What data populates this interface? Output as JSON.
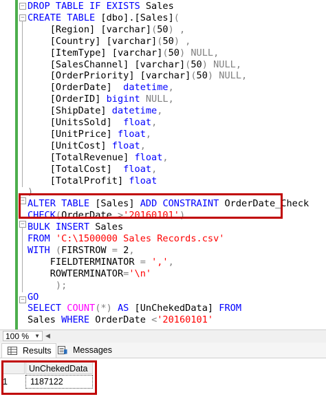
{
  "editor": {
    "lines": [
      [
        {
          "t": "DROP TABLE IF EXISTS",
          "c": "kw"
        },
        {
          "t": " Sales",
          "c": ""
        }
      ],
      [
        {
          "t": "CREATE TABLE",
          "c": "kw"
        },
        {
          "t": " [dbo].[Sales]",
          "c": ""
        },
        {
          "t": "(",
          "c": "gray"
        }
      ],
      [
        {
          "t": "    [Region] [varchar]",
          "c": ""
        },
        {
          "t": "(",
          "c": "gray"
        },
        {
          "t": "50",
          "c": ""
        },
        {
          "t": ") ,",
          "c": "gray"
        }
      ],
      [
        {
          "t": "    [Country] [varchar]",
          "c": ""
        },
        {
          "t": "(",
          "c": "gray"
        },
        {
          "t": "50",
          "c": ""
        },
        {
          "t": ") ,",
          "c": "gray"
        }
      ],
      [
        {
          "t": "    [ItemType] [varchar]",
          "c": ""
        },
        {
          "t": "(",
          "c": "gray"
        },
        {
          "t": "50",
          "c": ""
        },
        {
          "t": ") NULL,",
          "c": "gray"
        }
      ],
      [
        {
          "t": "    [SalesChannel] [varchar]",
          "c": ""
        },
        {
          "t": "(",
          "c": "gray"
        },
        {
          "t": "50",
          "c": ""
        },
        {
          "t": ") NULL,",
          "c": "gray"
        }
      ],
      [
        {
          "t": "    [OrderPriority] [varchar]",
          "c": ""
        },
        {
          "t": "(",
          "c": "gray"
        },
        {
          "t": "50",
          "c": ""
        },
        {
          "t": ") NULL,",
          "c": "gray"
        }
      ],
      [
        {
          "t": "    [OrderDate]  ",
          "c": ""
        },
        {
          "t": "datetime",
          "c": "kw"
        },
        {
          "t": ",",
          "c": "gray"
        }
      ],
      [
        {
          "t": "    [OrderID] ",
          "c": ""
        },
        {
          "t": "bigint",
          "c": "kw"
        },
        {
          "t": " NULL,",
          "c": "gray"
        }
      ],
      [
        {
          "t": "    [ShipDate] ",
          "c": ""
        },
        {
          "t": "datetime",
          "c": "kw"
        },
        {
          "t": ",",
          "c": "gray"
        }
      ],
      [
        {
          "t": "    [UnitsSold]  ",
          "c": ""
        },
        {
          "t": "float",
          "c": "kw"
        },
        {
          "t": ",",
          "c": "gray"
        }
      ],
      [
        {
          "t": "    [UnitPrice] ",
          "c": ""
        },
        {
          "t": "float",
          "c": "kw"
        },
        {
          "t": ",",
          "c": "gray"
        }
      ],
      [
        {
          "t": "    [UnitCost] ",
          "c": ""
        },
        {
          "t": "float",
          "c": "kw"
        },
        {
          "t": ",",
          "c": "gray"
        }
      ],
      [
        {
          "t": "    [TotalRevenue] ",
          "c": ""
        },
        {
          "t": "float",
          "c": "kw"
        },
        {
          "t": ",",
          "c": "gray"
        }
      ],
      [
        {
          "t": "    [TotalCost]  ",
          "c": ""
        },
        {
          "t": "float",
          "c": "kw"
        },
        {
          "t": ",",
          "c": "gray"
        }
      ],
      [
        {
          "t": "    [TotalProfit] ",
          "c": ""
        },
        {
          "t": "float",
          "c": "kw"
        }
      ],
      [
        {
          "t": ")",
          "c": "gray"
        }
      ],
      [
        {
          "t": "ALTER TABLE",
          "c": "kw"
        },
        {
          "t": " [Sales] ",
          "c": ""
        },
        {
          "t": "ADD CONSTRAINT",
          "c": "kw"
        },
        {
          "t": " OrderDate_Check",
          "c": ""
        }
      ],
      [
        {
          "t": "CHECK",
          "c": "kw"
        },
        {
          "t": "(",
          "c": "gray"
        },
        {
          "t": "OrderDate ",
          "c": ""
        },
        {
          "t": ">",
          "c": "gray"
        },
        {
          "t": "'20160101'",
          "c": "str"
        },
        {
          "t": ")",
          "c": "gray"
        }
      ],
      [
        {
          "t": "BULK INSERT",
          "c": "kw"
        },
        {
          "t": " Sales",
          "c": ""
        }
      ],
      [
        {
          "t": "FROM",
          "c": "kw"
        },
        {
          "t": " ",
          "c": ""
        },
        {
          "t": "'C:\\1500000 Sales Records.csv'",
          "c": "str"
        }
      ],
      [
        {
          "t": "WITH",
          "c": "kw"
        },
        {
          "t": " (",
          "c": "gray"
        },
        {
          "t": "FIRSTROW ",
          "c": ""
        },
        {
          "t": "=",
          "c": "gray"
        },
        {
          "t": " 2",
          "c": ""
        },
        {
          "t": ",",
          "c": "gray"
        }
      ],
      [
        {
          "t": "    FIELDTERMINATOR ",
          "c": ""
        },
        {
          "t": "=",
          "c": "gray"
        },
        {
          "t": " ",
          "c": ""
        },
        {
          "t": "','",
          "c": "str"
        },
        {
          "t": ",",
          "c": "gray"
        }
      ],
      [
        {
          "t": "    ROWTERMINATOR",
          "c": ""
        },
        {
          "t": "=",
          "c": "gray"
        },
        {
          "t": "'\\n'",
          "c": "str"
        }
      ],
      [
        {
          "t": "     );",
          "c": "gray"
        }
      ],
      [
        {
          "t": "GO",
          "c": "kw"
        }
      ],
      [
        {
          "t": "SELECT",
          "c": "kw"
        },
        {
          "t": " ",
          "c": ""
        },
        {
          "t": "COUNT",
          "c": "fn"
        },
        {
          "t": "(",
          "c": "gray"
        },
        {
          "t": "*",
          "c": "gray"
        },
        {
          "t": ")",
          "c": "gray"
        },
        {
          "t": " ",
          "c": ""
        },
        {
          "t": "AS",
          "c": "kw"
        },
        {
          "t": " [UnChekedData] ",
          "c": ""
        },
        {
          "t": "FROM",
          "c": "kw"
        }
      ],
      [
        {
          "t": "Sales ",
          "c": ""
        },
        {
          "t": "WHERE",
          "c": "kw"
        },
        {
          "t": " OrderDate ",
          "c": ""
        },
        {
          "t": "<",
          "c": "gray"
        },
        {
          "t": "'20160101'",
          "c": "str"
        }
      ]
    ]
  },
  "status_bar": {
    "zoom": "100 %"
  },
  "tabs": {
    "results": "Results",
    "messages": "Messages"
  },
  "results": {
    "column_header": "UnChekedData",
    "row_number": "1",
    "value": "1187122"
  },
  "colors": {
    "highlight_box": "#c00000",
    "keyword": "#0000ff",
    "string": "#ff0000",
    "function": "#ff00ff"
  }
}
